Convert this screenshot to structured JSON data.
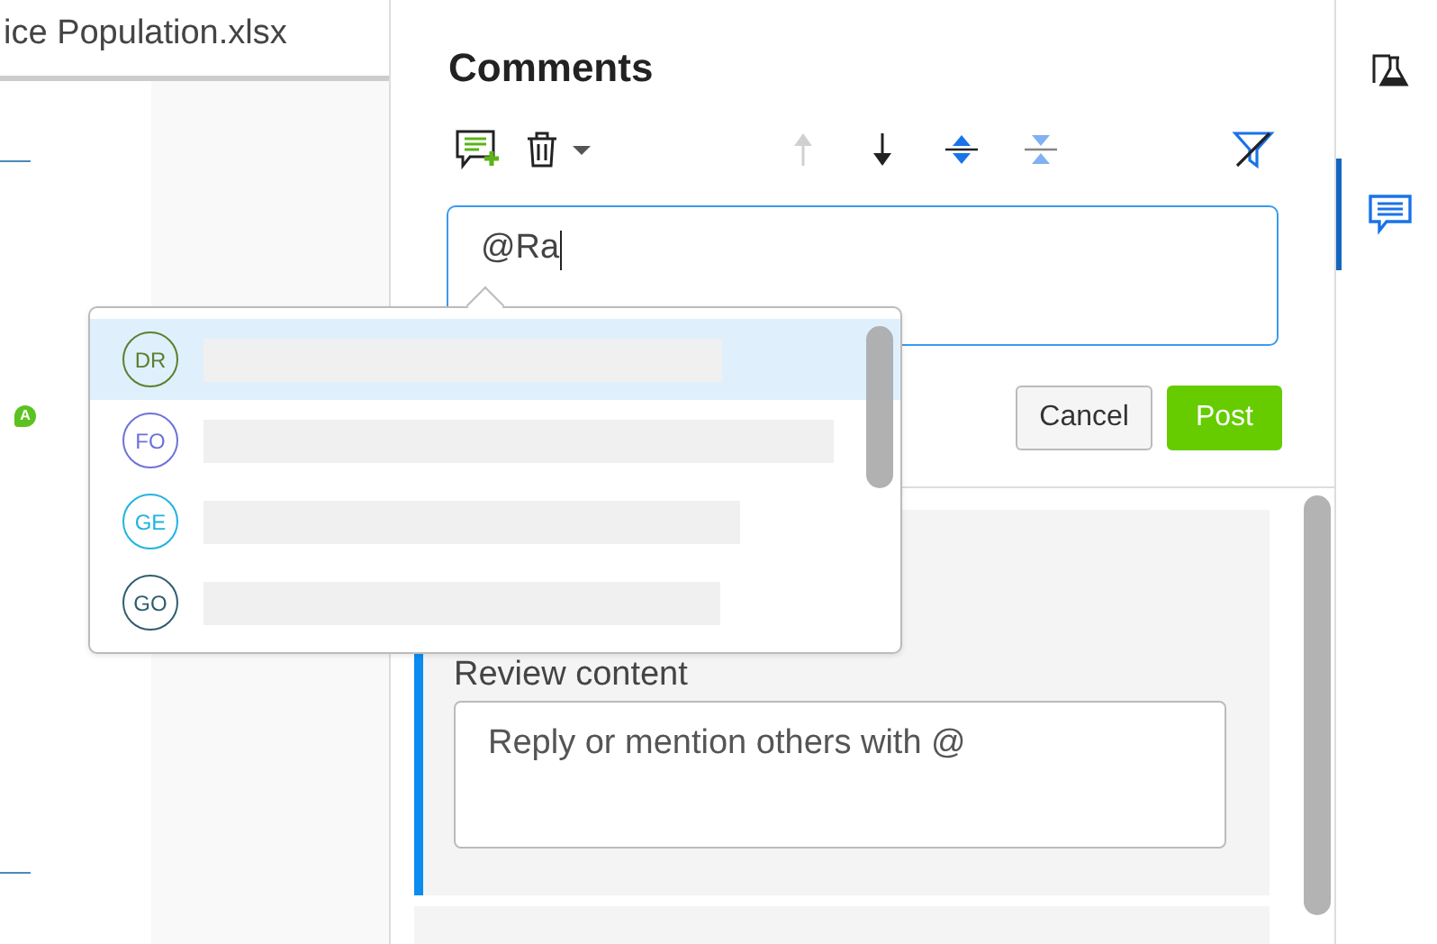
{
  "document": {
    "title": "ice Population.xlsx",
    "badge": "A"
  },
  "comments": {
    "title": "Comments",
    "toolbar": [
      {
        "kind": "add",
        "disabled": false
      },
      {
        "kind": "delete",
        "disabled": false
      },
      {
        "kind": "prev",
        "disabled": true
      },
      {
        "kind": "next",
        "disabled": false
      },
      {
        "kind": "expand",
        "disabled": false
      },
      {
        "kind": "collapse",
        "disabled": true
      },
      {
        "kind": "filter",
        "disabled": false
      }
    ],
    "input": {
      "value": "@Ra"
    },
    "buttons": [
      {
        "label": "Cancel",
        "kind": "secondary"
      },
      {
        "label": "Post",
        "kind": "primary"
      }
    ],
    "thread": {
      "text": "Review content",
      "reply_placeholder": "Reply or mention others with @"
    }
  },
  "mentions": [
    {
      "initials": "DR",
      "color": "#5b7f2e",
      "selected": true
    },
    {
      "initials": "FO",
      "color": "#6e72d8",
      "selected": false
    },
    {
      "initials": "GE",
      "color": "#1fb3e0",
      "selected": false
    },
    {
      "initials": "GO",
      "color": "#2f5d6e",
      "selected": false
    }
  ],
  "rail": [
    {
      "kind": "flask",
      "selected": false
    },
    {
      "kind": "comments",
      "selected": true
    }
  ]
}
